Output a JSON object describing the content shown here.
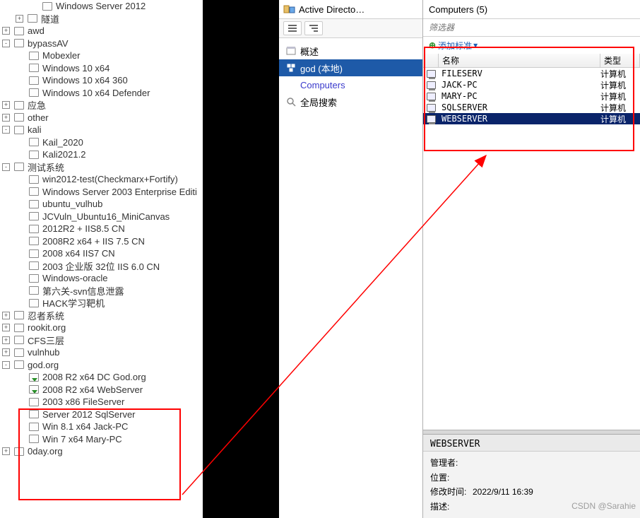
{
  "tree": [
    {
      "ind": 2,
      "toggle": "",
      "icon": "box",
      "label": "Windows Server 2012"
    },
    {
      "ind": 1,
      "toggle": "+",
      "icon": "box",
      "label": "隧道"
    },
    {
      "ind": 0,
      "toggle": "+",
      "icon": "box",
      "label": "awd"
    },
    {
      "ind": 0,
      "toggle": "-",
      "icon": "box",
      "label": "bypassAV"
    },
    {
      "ind": 1,
      "toggle": "",
      "icon": "box",
      "label": "Mobexler"
    },
    {
      "ind": 1,
      "toggle": "",
      "icon": "box",
      "label": "Windows 10 x64"
    },
    {
      "ind": 1,
      "toggle": "",
      "icon": "box",
      "label": "Windows 10 x64 360"
    },
    {
      "ind": 1,
      "toggle": "",
      "icon": "box",
      "label": "Windows 10 x64 Defender"
    },
    {
      "ind": 0,
      "toggle": "+",
      "icon": "box",
      "label": "应急"
    },
    {
      "ind": 0,
      "toggle": "+",
      "icon": "box",
      "label": "other"
    },
    {
      "ind": 0,
      "toggle": "-",
      "icon": "box",
      "label": "kali"
    },
    {
      "ind": 1,
      "toggle": "",
      "icon": "box",
      "label": "Kail_2020"
    },
    {
      "ind": 1,
      "toggle": "",
      "icon": "box",
      "label": "Kali2021.2"
    },
    {
      "ind": 0,
      "toggle": "-",
      "icon": "box",
      "label": "测试系统"
    },
    {
      "ind": 1,
      "toggle": "",
      "icon": "box",
      "label": "win2012-test(Checkmarx+Fortify)"
    },
    {
      "ind": 1,
      "toggle": "",
      "icon": "box",
      "label": "Windows Server 2003 Enterprise Editi"
    },
    {
      "ind": 1,
      "toggle": "",
      "icon": "box",
      "label": "ubuntu_vulhub"
    },
    {
      "ind": 1,
      "toggle": "",
      "icon": "box",
      "label": "JCVuln_Ubuntu16_MiniCanvas"
    },
    {
      "ind": 1,
      "toggle": "",
      "icon": "box",
      "label": "2012R2 + IIS8.5 CN"
    },
    {
      "ind": 1,
      "toggle": "",
      "icon": "box",
      "label": "2008R2 x64 + IIS 7.5 CN"
    },
    {
      "ind": 1,
      "toggle": "",
      "icon": "box",
      "label": "2008 x64 IIS7 CN"
    },
    {
      "ind": 1,
      "toggle": "",
      "icon": "box",
      "label": "2003 企业版 32位 IIS 6.0 CN"
    },
    {
      "ind": 1,
      "toggle": "",
      "icon": "box",
      "label": "Windows-oracle"
    },
    {
      "ind": 1,
      "toggle": "",
      "icon": "box",
      "label": "第六关-svn信息泄露"
    },
    {
      "ind": 1,
      "toggle": "",
      "icon": "box",
      "label": "HACK学习靶机"
    },
    {
      "ind": 0,
      "toggle": "+",
      "icon": "box",
      "label": "忍者系统"
    },
    {
      "ind": 0,
      "toggle": "+",
      "icon": "box",
      "label": "rookit.org"
    },
    {
      "ind": 0,
      "toggle": "+",
      "icon": "box",
      "label": "CFS三层"
    },
    {
      "ind": 0,
      "toggle": "+",
      "icon": "box",
      "label": "vulnhub"
    },
    {
      "ind": 0,
      "toggle": "-",
      "icon": "box",
      "label": "god.org"
    },
    {
      "ind": 1,
      "toggle": "",
      "icon": "green",
      "label": "2008 R2 x64 DC God.org"
    },
    {
      "ind": 1,
      "toggle": "",
      "icon": "green",
      "label": "2008 R2 x64 WebServer"
    },
    {
      "ind": 1,
      "toggle": "",
      "icon": "box",
      "label": "2003 x86 FileServer"
    },
    {
      "ind": 1,
      "toggle": "",
      "icon": "box",
      "label": "Server 2012 SqlServer"
    },
    {
      "ind": 1,
      "toggle": "",
      "icon": "box",
      "label": "Win 8.1 x64 Jack-PC"
    },
    {
      "ind": 1,
      "toggle": "",
      "icon": "box",
      "label": "Win 7 x64 Mary-PC"
    },
    {
      "ind": 0,
      "toggle": "+",
      "icon": "box",
      "label": "0day.org"
    }
  ],
  "ad": {
    "title": "Active Directo…",
    "nav": {
      "overview": "概述",
      "domain": "god (本地)",
      "computers": "Computers",
      "global_search": "全局搜索"
    }
  },
  "computers": {
    "title": "Computers (5)",
    "filter_placeholder": "筛选器",
    "add_criteria": "添加标准",
    "columns": {
      "name": "名称",
      "type": "类型"
    },
    "rows": [
      {
        "name": "FILESERV",
        "type": "计算机",
        "sel": false
      },
      {
        "name": "JACK-PC",
        "type": "计算机",
        "sel": false
      },
      {
        "name": "MARY-PC",
        "type": "计算机",
        "sel": false
      },
      {
        "name": "SQLSERVER",
        "type": "计算机",
        "sel": false
      },
      {
        "name": "WEBSERVER",
        "type": "计算机",
        "sel": true
      }
    ]
  },
  "details": {
    "title": "WEBSERVER",
    "rows": [
      {
        "k": "管理者:",
        "v": ""
      },
      {
        "k": "位置:",
        "v": ""
      },
      {
        "k": "修改时间:",
        "v": "2022/9/11 16:39"
      },
      {
        "k": "描述:",
        "v": ""
      }
    ]
  },
  "watermark": "CSDN @Sarahie"
}
